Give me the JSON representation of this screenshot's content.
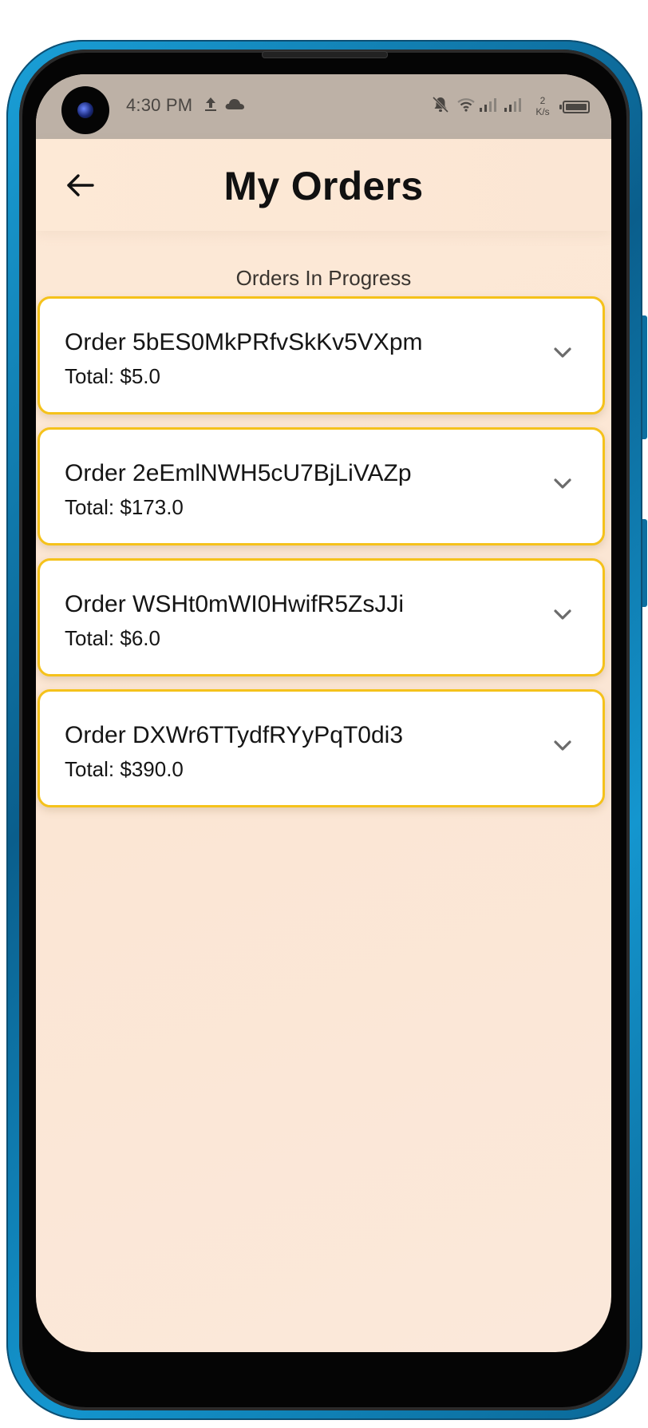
{
  "status_bar": {
    "time": "4:30 PM",
    "net_speed_value": "2",
    "net_speed_unit": "K/s",
    "icons": [
      "upload-icon",
      "cloud-icon",
      "bell-off-icon",
      "wifi-icon",
      "signal-icon",
      "signal-icon",
      "battery-icon"
    ]
  },
  "app_bar": {
    "title": "My Orders",
    "back_icon": "arrow-left-icon"
  },
  "section": {
    "label": "Orders In Progress"
  },
  "orders": [
    {
      "title": "Order 5bES0MkPRfvSkKv5VXpm",
      "total": "Total: $5.0"
    },
    {
      "title": "Order 2eEmlNWH5cU7BjLiVAZp",
      "total": "Total: $173.0"
    },
    {
      "title": "Order WSHt0mWI0HwifR5ZsJJi",
      "total": "Total: $6.0"
    },
    {
      "title": "Order DXWr6TTydfRYyPqT0di3",
      "total": "Total: $390.0"
    }
  ],
  "colors": {
    "card_border": "#f5c21b",
    "background": "#fbe6d4",
    "status_bar": "#bdb1a6",
    "phone_frame": "#1496cf"
  }
}
